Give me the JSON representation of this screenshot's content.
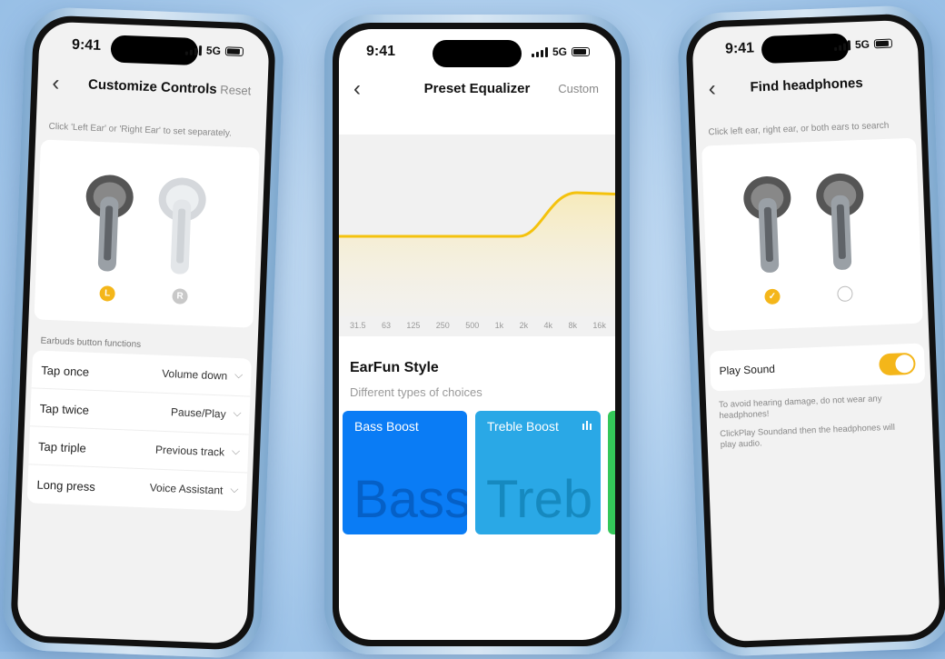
{
  "status": {
    "time": "9:41",
    "network": "5G"
  },
  "left": {
    "title": "Customize Controls",
    "reset": "Reset",
    "hint": "Click 'Left Ear' or 'Right Ear' to set separately.",
    "left_ear": "L",
    "right_ear": "R",
    "section": "Earbuds button functions",
    "rows": [
      {
        "label": "Tap once",
        "value": "Volume down"
      },
      {
        "label": "Tap twice",
        "value": "Pause/Play"
      },
      {
        "label": "Tap triple",
        "value": "Previous track"
      },
      {
        "label": "Long press",
        "value": "Voice Assistant"
      }
    ]
  },
  "center": {
    "title": "Preset Equalizer",
    "custom": "Custom",
    "bands": [
      "31.5",
      "63",
      "125",
      "250",
      "500",
      "1k",
      "2k",
      "4k",
      "8k",
      "16k"
    ],
    "style_title": "EarFun Style",
    "style_subtitle": "Different types of choices",
    "presets": [
      {
        "name": "Bass Boost",
        "bg_text": "Bass",
        "color": "#0a7cf5"
      },
      {
        "name": "Treble Boost",
        "bg_text": "Treb",
        "color": "#2aa8e6"
      }
    ],
    "accent": "#f4c20d"
  },
  "right": {
    "title": "Find headphones",
    "hint": "Click left ear, right ear, or both ears to search",
    "play_sound": "Play Sound",
    "play_sound_on": true,
    "warning1": "To avoid hearing damage, do not wear any headphones!",
    "warning2": "ClickPlay Soundand then the headphones will play audio.",
    "accent": "#f4b61a"
  }
}
